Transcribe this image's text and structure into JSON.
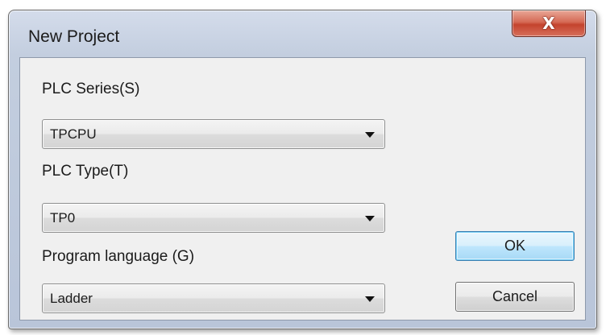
{
  "window": {
    "title": "New Project",
    "close_glyph": "X",
    "close_icon": "close-icon"
  },
  "form": {
    "plc_series": {
      "label": "PLC Series(S)",
      "value": "TPCPU"
    },
    "plc_type": {
      "label": "PLC Type(T)",
      "value": "TP0"
    },
    "program_language": {
      "label": "Program language (G)",
      "value": "Ladder"
    }
  },
  "buttons": {
    "ok": "OK",
    "cancel": "Cancel"
  },
  "colors": {
    "close_button": "#c4432d",
    "default_button_border": "#3c7fb1",
    "client_background": "#f0f0f0"
  }
}
